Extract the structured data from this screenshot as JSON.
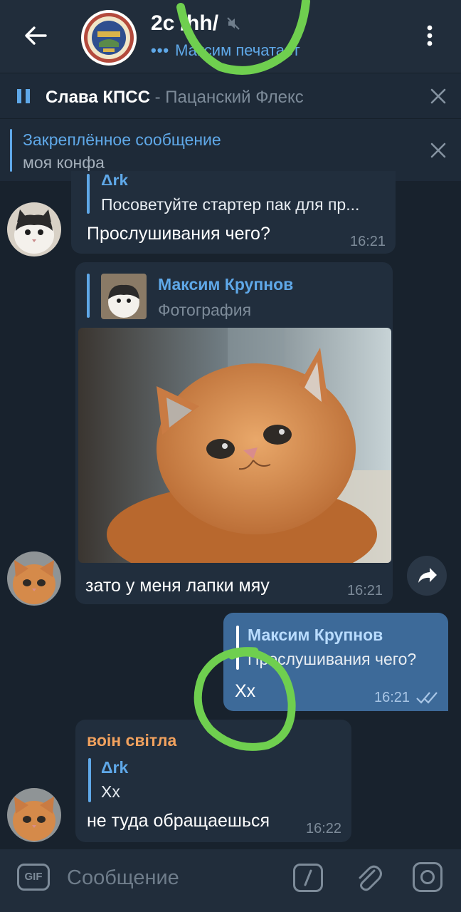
{
  "header": {
    "title": "2c /hh/",
    "typing_dots": "•••",
    "typing_text": "Максим печатает"
  },
  "player": {
    "song": "Слава КПСС",
    "separator": " - ",
    "artist": "Пацанский Флекс"
  },
  "pinned": {
    "title": "Закреплённое сообщение",
    "text": "моя конфа"
  },
  "messages": [
    {
      "reply_name": "Δrk",
      "reply_text": "Посоветуйте стартер пак для пр...",
      "text": "Прослушивания чего?",
      "time": "16:21"
    },
    {
      "reply_name": "Максим Крупнов",
      "reply_text": "Фотография",
      "text": "зато у меня лапки мяу",
      "time": "16:21"
    },
    {
      "reply_name": "Максим Крупнов",
      "reply_text": "Прослушивания чего?",
      "text": "Хх",
      "time": "16:21"
    },
    {
      "sender": "воін світла",
      "reply_name": "Δrk",
      "reply_text": "Хх",
      "text": "не туда обращаешься",
      "time": "16:22"
    }
  ],
  "input": {
    "gif_label": "GIF",
    "placeholder": "Сообщение"
  },
  "colors": {
    "background": "#18222d",
    "header": "#212d3b",
    "accent": "#5fa8e8",
    "outgoing_bubble": "#3d6a99",
    "incoming_bubble": "#212e3d",
    "sender_name": "#f2a25e",
    "scribble": "#6fcf4f"
  },
  "icons": [
    "back-arrow-icon",
    "mute-icon",
    "more-vertical-icon",
    "pause-icon",
    "close-icon",
    "share-icon",
    "read-checks-icon",
    "gif-icon",
    "slash-command-icon",
    "attach-icon",
    "camera-icon"
  ]
}
